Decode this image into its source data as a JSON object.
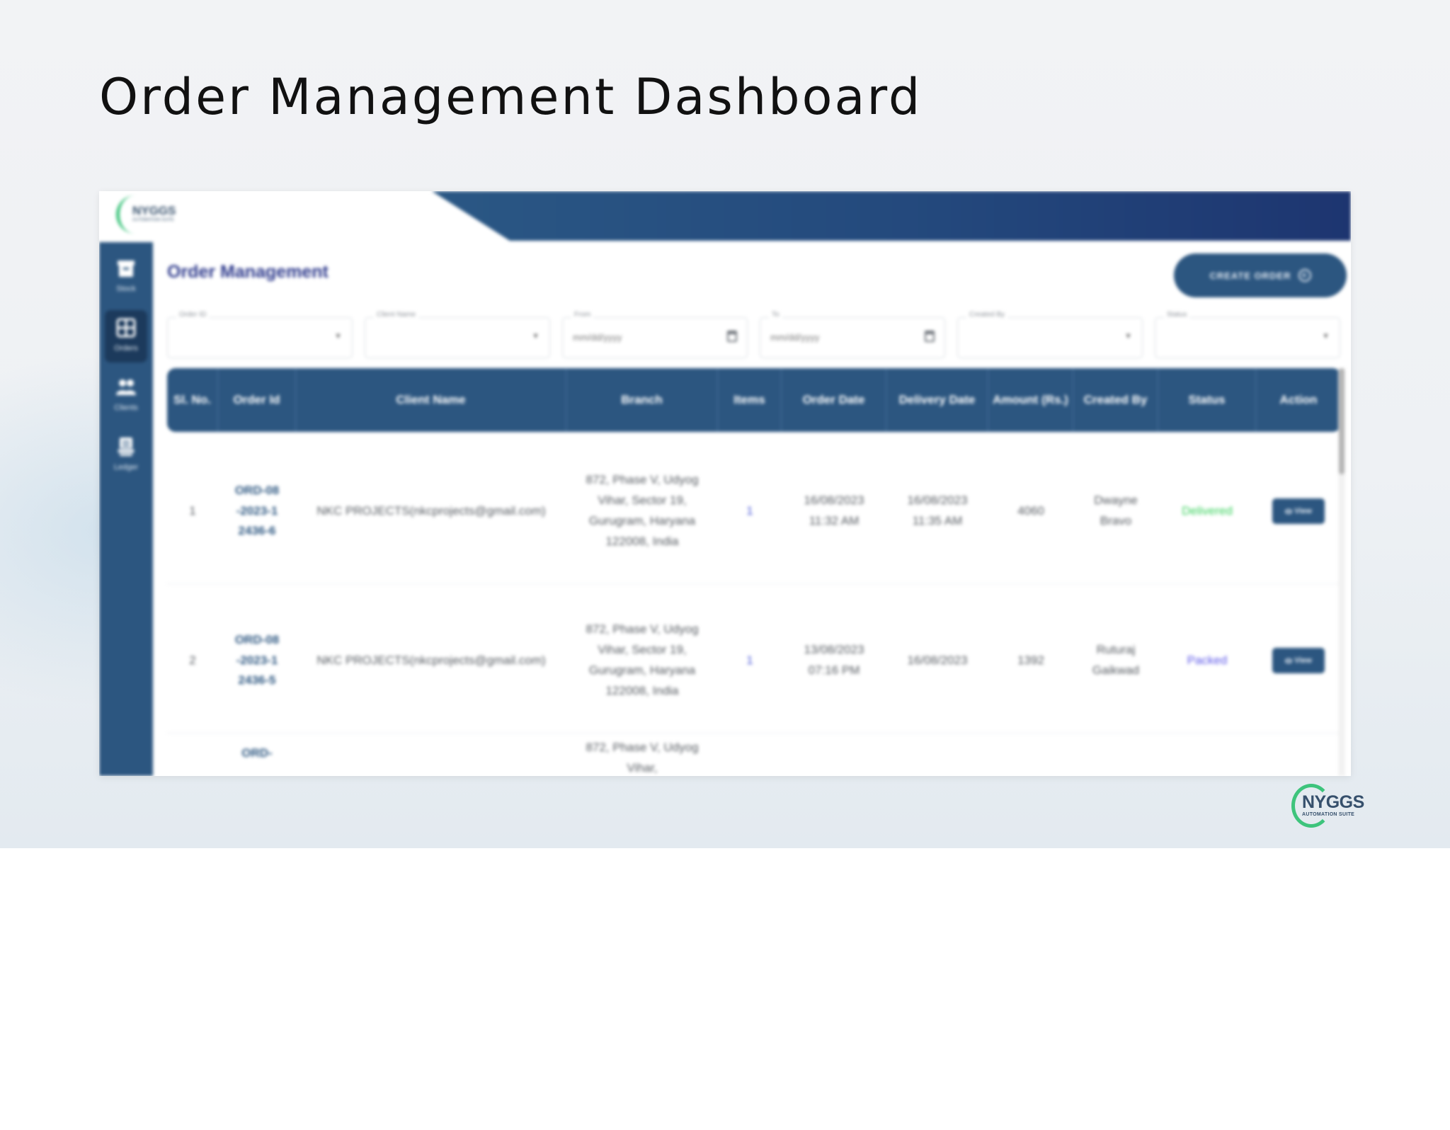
{
  "slide": {
    "title": "Order Management Dashboard"
  },
  "app": {
    "logo_text": "NYGGS",
    "logo_sub": "AUTOMATION SUITE",
    "page_title": "Order Management",
    "create_button": "CREATE ORDER",
    "sidebar": [
      {
        "label": "Stock",
        "icon": "box-icon",
        "active": false
      },
      {
        "label": "Orders",
        "icon": "grid-icon",
        "active": true
      },
      {
        "label": "Clients",
        "icon": "users-icon",
        "active": false
      },
      {
        "label": "Ledger",
        "icon": "ledger-icon",
        "active": false
      }
    ],
    "filters": [
      {
        "label": "Order ID",
        "value": "",
        "kind": "select"
      },
      {
        "label": "Client Name",
        "value": "",
        "kind": "select"
      },
      {
        "label": "From",
        "value": "mm/dd/yyyy",
        "kind": "date"
      },
      {
        "label": "To",
        "value": "mm/dd/yyyy",
        "kind": "date"
      },
      {
        "label": "Created By",
        "value": "",
        "kind": "select"
      },
      {
        "label": "Status",
        "value": "",
        "kind": "select"
      }
    ],
    "table": {
      "columns": [
        "Sl. No.",
        "Order Id",
        "Client Name",
        "Branch",
        "Items",
        "Order Date",
        "Delivery Date",
        "Amount (Rs.)",
        "Created By",
        "Status",
        "Action"
      ],
      "rows": [
        {
          "sl": "1",
          "order_id": "ORD-08-2023-12436-6",
          "client": "NKC PROJECTS(nkcprojects@gmail.com)",
          "branch": "872, Phase V, Udyog Vihar, Sector 19, Gurugram, Haryana 122008, India",
          "items": "1",
          "order_date": "16/08/2023 11:32 AM",
          "delivery_date": "16/08/2023 11:35 AM",
          "amount": "4060",
          "created_by": "Dwayne Bravo",
          "status": "Delivered",
          "action": "View"
        },
        {
          "sl": "2",
          "order_id": "ORD-08-2023-12436-5",
          "client": "NKC PROJECTS(nkcprojects@gmail.com)",
          "branch": "872, Phase V, Udyog Vihar, Sector 19, Gurugram, Haryana 122008, India",
          "items": "1",
          "order_date": "13/08/2023 07:16 PM",
          "delivery_date": "16/08/2023",
          "amount": "1392",
          "created_by": "Ruturaj Gaikwad",
          "status": "Packed",
          "action": "View"
        },
        {
          "sl": "",
          "order_id": "ORD-",
          "client": "",
          "branch": "872, Phase V, Udyog Vihar,",
          "items": "",
          "order_date": "",
          "delivery_date": "",
          "amount": "",
          "created_by": "",
          "status": "",
          "action": ""
        }
      ]
    }
  },
  "footer_logo": {
    "text": "NYGGS",
    "sub": "AUTOMATION SUITE"
  },
  "colors": {
    "primary": "#2c5680",
    "title_purple": "#2e3a8c",
    "delivered": "#34d058",
    "packed": "#5a55e8",
    "logo_green": "#3ec47c"
  }
}
